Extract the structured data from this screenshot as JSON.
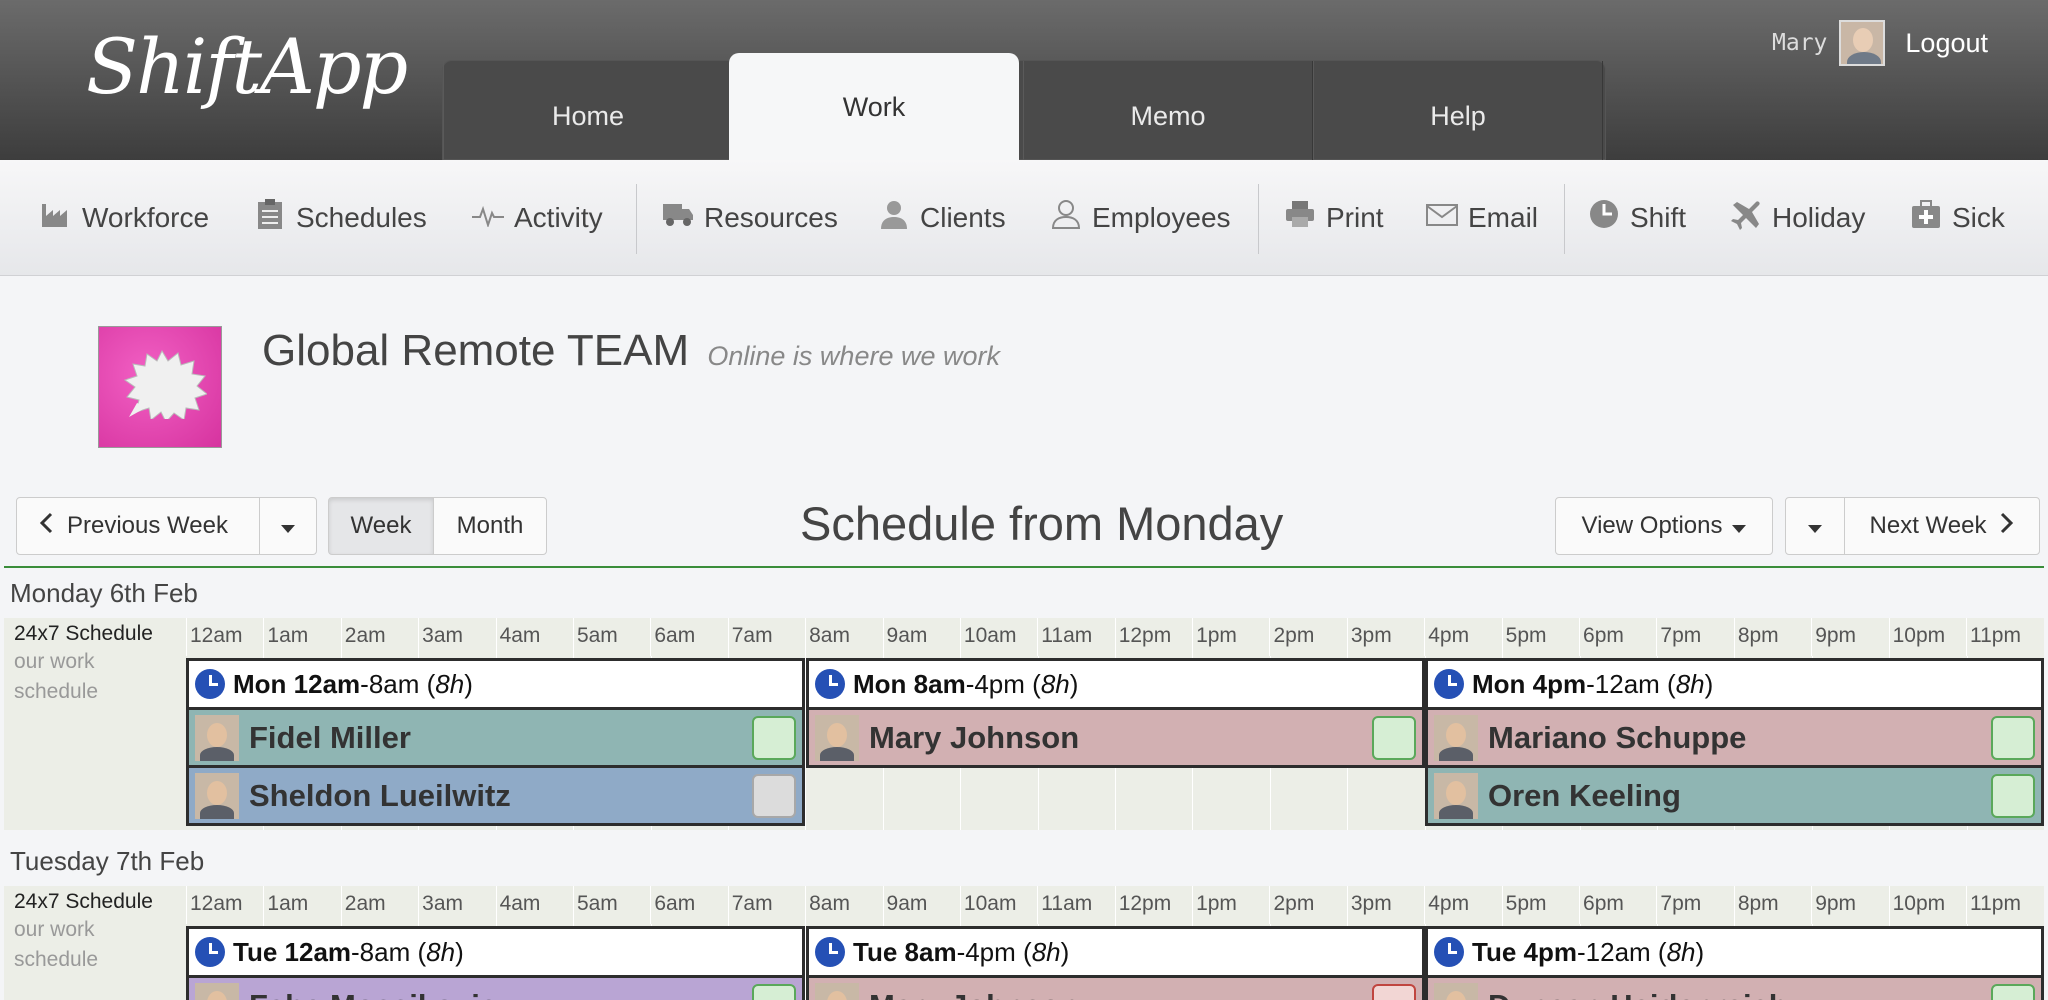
{
  "app": {
    "logo": "ShiftApp",
    "user_name": "Mary",
    "logout_label": "Logout"
  },
  "main_tabs": [
    {
      "label": "Home"
    },
    {
      "label": "Work",
      "active": true
    },
    {
      "label": "Memo"
    },
    {
      "label": "Help"
    }
  ],
  "toolbar": {
    "workforce": "Workforce",
    "schedules": "Schedules",
    "activity": "Activity",
    "resources": "Resources",
    "clients": "Clients",
    "employees": "Employees",
    "print": "Print",
    "email": "Email",
    "shift": "Shift",
    "holiday": "Holiday",
    "sick": "Sick"
  },
  "team": {
    "name": "Global Remote TEAM",
    "motto": "Online is where we work"
  },
  "nav": {
    "previous_week": "Previous Week",
    "week": "Week",
    "month": "Month",
    "title": "Schedule from Monday",
    "view_options": "View Options",
    "next_week": "Next Week"
  },
  "schedule": {
    "hours": [
      "12am",
      "1am",
      "2am",
      "3am",
      "4am",
      "5am",
      "6am",
      "7am",
      "8am",
      "9am",
      "10am",
      "11am",
      "12pm",
      "1pm",
      "2pm",
      "3pm",
      "4pm",
      "5pm",
      "6pm",
      "7pm",
      "8pm",
      "9pm",
      "10pm",
      "11pm"
    ],
    "schedule_name": "24x7 Schedule",
    "schedule_desc_1": "our work",
    "schedule_desc_2": "schedule",
    "days": [
      {
        "title": "Monday 6th Feb",
        "shifts": [
          {
            "start": "Mon 12am",
            "end": "-8am (",
            "dur": "8h",
            "close": ")",
            "employees": [
              {
                "name": "Fidel Miller",
                "color": "#8fb5b3",
                "status": "green"
              },
              {
                "name": "Sheldon Lueilwitz",
                "color": "#8faac7",
                "status": "gray"
              }
            ]
          },
          {
            "start": "Mon 8am",
            "end": "-4pm (",
            "dur": "8h",
            "close": ")",
            "employees": [
              {
                "name": "Mary Johnson",
                "color": "#d2b0b2",
                "status": "green"
              }
            ]
          },
          {
            "start": "Mon 4pm",
            "end": "-12am (",
            "dur": "8h",
            "close": ")",
            "employees": [
              {
                "name": "Mariano Schuppe",
                "color": "#d2b0b2",
                "status": "green"
              },
              {
                "name": "Oren Keeling",
                "color": "#8fb5b3",
                "status": "green"
              }
            ]
          }
        ]
      },
      {
        "title": "Tuesday 7th Feb",
        "shifts": [
          {
            "start": "Tue 12am",
            "end": "-8am (",
            "dur": "8h",
            "close": ")",
            "employees": [
              {
                "name": "Fabe Mossikovic",
                "color": "#b9a5d4",
                "status": "green"
              }
            ]
          },
          {
            "start": "Tue 8am",
            "end": "-4pm (",
            "dur": "8h",
            "close": ")",
            "employees": [
              {
                "name": "Mary Johnson",
                "color": "#d2b0b2",
                "status": "red"
              }
            ]
          },
          {
            "start": "Tue 4pm",
            "end": "-12am (",
            "dur": "8h",
            "close": ")",
            "employees": [
              {
                "name": "Duncan Heidenreich",
                "color": "#d2b0b2",
                "status": "green"
              }
            ]
          }
        ]
      }
    ]
  }
}
